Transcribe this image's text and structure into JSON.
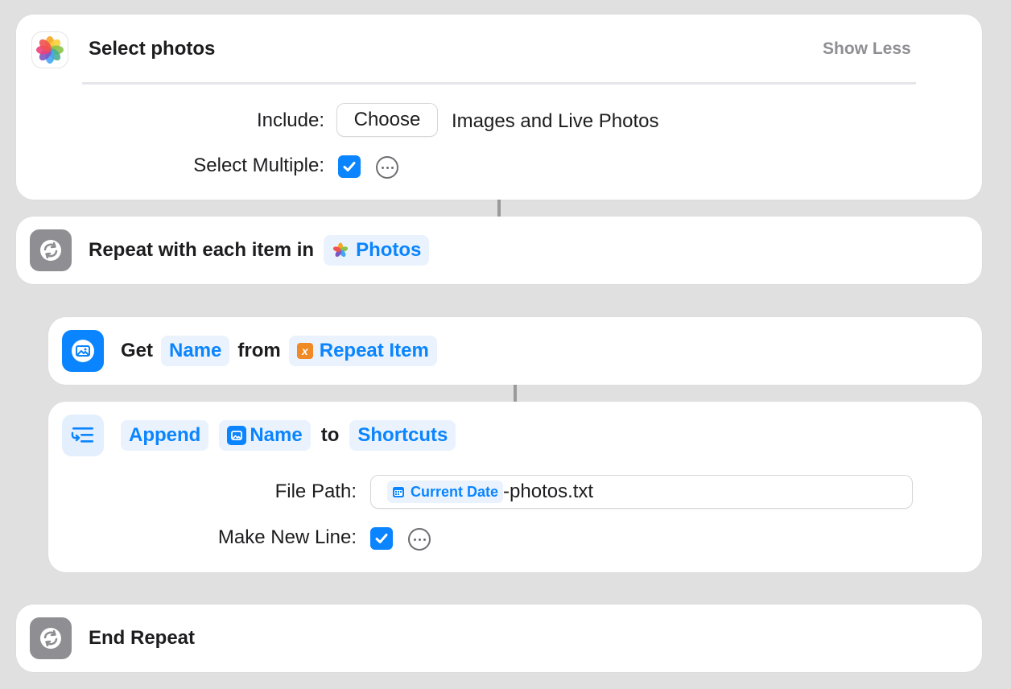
{
  "select_photos": {
    "title": "Select photos",
    "show_less_label": "Show Less",
    "include_label": "Include:",
    "choose_button": "Choose",
    "include_value": "Images and Live Photos",
    "select_multiple_label": "Select Multiple:",
    "select_multiple_checked": true,
    "icon": "photos-app-icon"
  },
  "repeat": {
    "label": "Repeat with each item in",
    "variable": "Photos",
    "icon": "repeat-icon"
  },
  "get_name": {
    "get_word": "Get",
    "property_token": "Name",
    "from_word": "from",
    "source_token": "Repeat Item",
    "icon": "image-icon"
  },
  "append": {
    "action_token": "Append",
    "variable_token": "Name",
    "to_word": "to",
    "target_token": "Shortcuts",
    "file_path_label": "File Path:",
    "file_path_variable": "Current Date",
    "file_path_suffix": "-photos.txt",
    "new_line_label": "Make New Line:",
    "new_line_checked": true,
    "icon": "append-text-icon"
  },
  "end_repeat": {
    "label": "End Repeat",
    "icon": "repeat-icon"
  },
  "colors": {
    "accent": "#0a84ff",
    "token_bg": "#eaf3fd",
    "card_bg": "#ffffff",
    "canvas_bg": "#e0e0e0",
    "gray_icon": "#8e8e93"
  }
}
